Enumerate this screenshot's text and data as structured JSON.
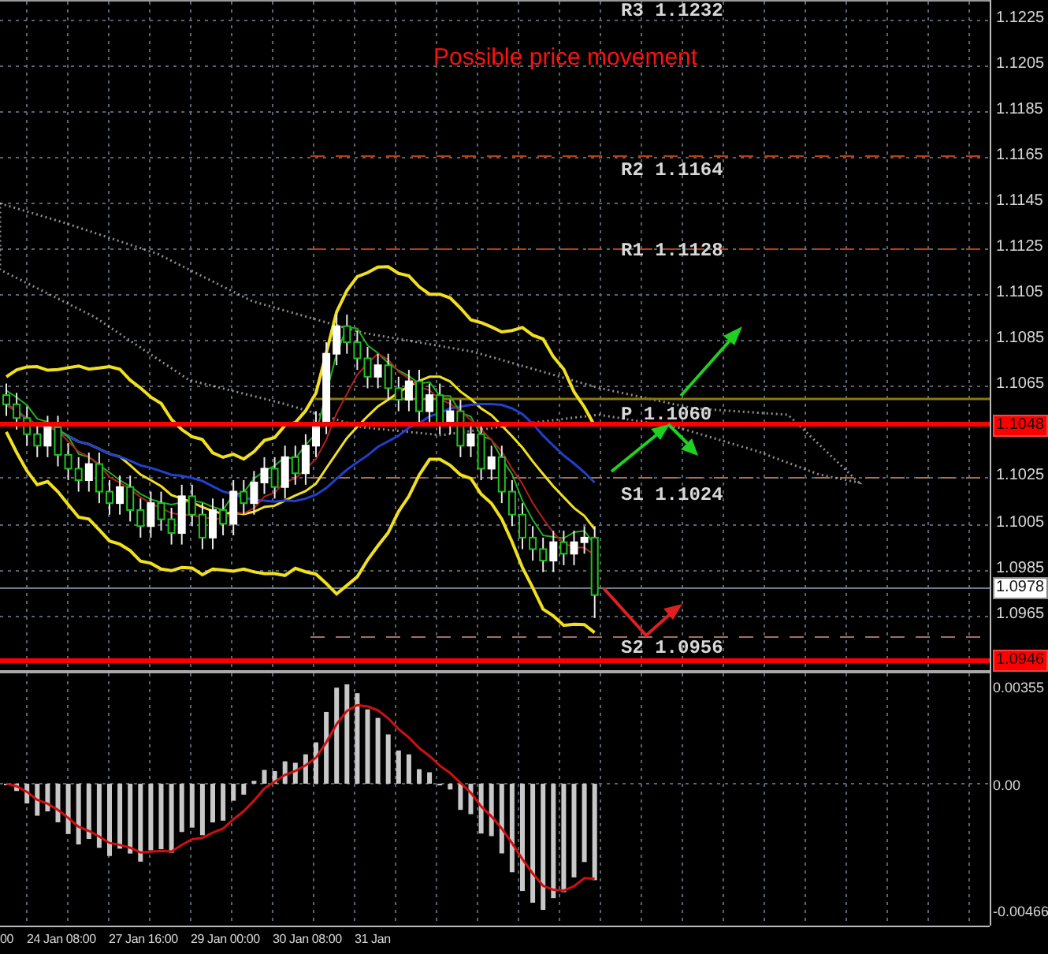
{
  "chart_title": "Possible price movement",
  "pivot_levels": [
    {
      "label": "R3 1.1232",
      "kind": "top"
    },
    {
      "label": "R2 1.1164",
      "kind": "resistance"
    },
    {
      "label": "R1 1.1128",
      "kind": "resistance"
    },
    {
      "label": "P 1.1060",
      "kind": "pivot"
    },
    {
      "label": "S1 1.1024",
      "kind": "support"
    },
    {
      "label": "S2 1.0956",
      "kind": "support"
    }
  ],
  "price_axis": [
    "1.1225",
    "1.1205",
    "1.1185",
    "1.1165",
    "1.1145",
    "1.1125",
    "1.1105",
    "1.1085",
    "1.1065",
    "1.1025",
    "1.1005",
    "1.0985",
    "1.0965"
  ],
  "price_tags": [
    {
      "label": "1.1048",
      "kind": "level"
    },
    {
      "label": "1.0978",
      "kind": "current"
    },
    {
      "label": "1.0946",
      "kind": "level"
    }
  ],
  "indicator_axis": [
    "0.00355",
    "0.00",
    "-0.00466"
  ],
  "time_axis": [
    "00",
    "24 Jan 08:00",
    "27 Jan 16:00",
    "29 Jan 00:00",
    "30 Jan 08:00",
    "31 Jan"
  ]
}
